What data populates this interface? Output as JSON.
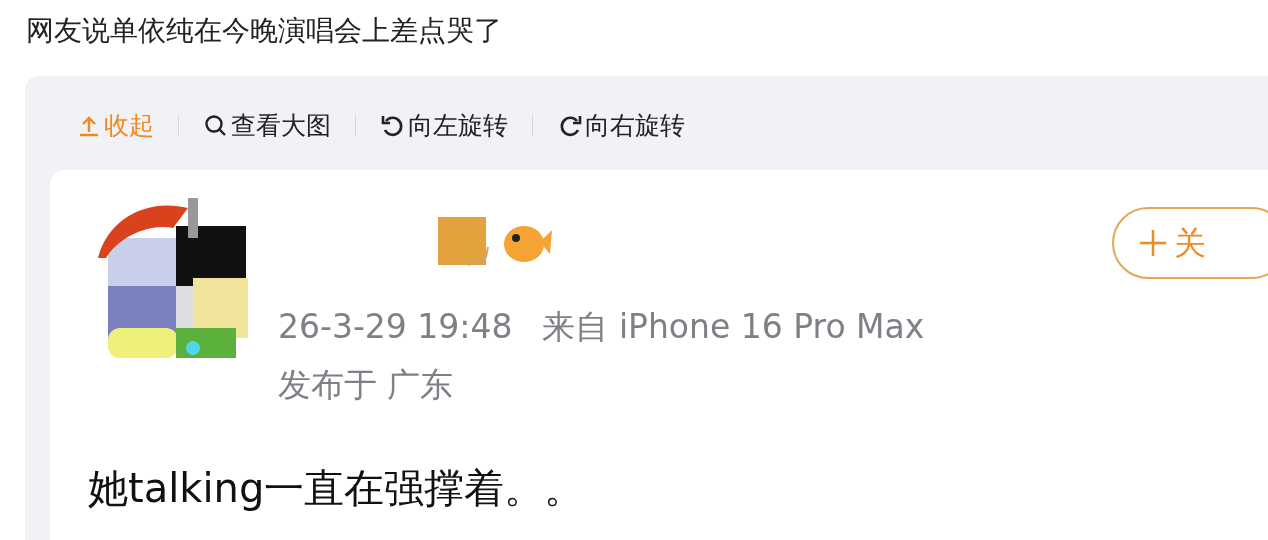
{
  "headline": "网友说单依纯在今晚演唱会上差点哭了",
  "toolbar": [
    {
      "kind": "collapse",
      "label": "收起"
    },
    {
      "kind": "zoom",
      "label": "查看大图"
    },
    {
      "kind": "rotate_left",
      "label": "向左旋转"
    },
    {
      "kind": "rotate_right",
      "label": "向右旋转"
    }
  ],
  "post": {
    "follow_button": {
      "label": "关"
    },
    "time": "26-3-29 19:48",
    "source": "来自 iPhone 16 Pro Max",
    "location": "发布于 广东",
    "text": "她talking一直在强撑着。。"
  }
}
